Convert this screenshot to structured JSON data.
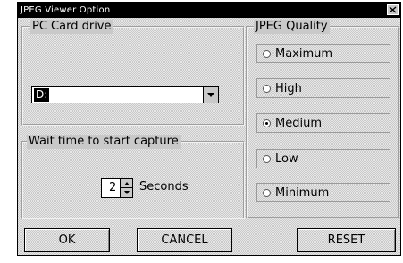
{
  "window": {
    "title": "JPEG Viewer Option"
  },
  "pc_card": {
    "legend": "PC Card drive",
    "selected_drive": "D:"
  },
  "wait": {
    "legend": "Wait time to start capture",
    "value": "2",
    "unit": "Seconds"
  },
  "quality": {
    "legend": "JPEG Quality",
    "options": [
      "Maximum",
      "High",
      "Medium",
      "Low",
      "Minimum"
    ],
    "selected": "Medium"
  },
  "buttons": {
    "ok": "OK",
    "cancel": "CANCEL",
    "reset": "RESET"
  }
}
